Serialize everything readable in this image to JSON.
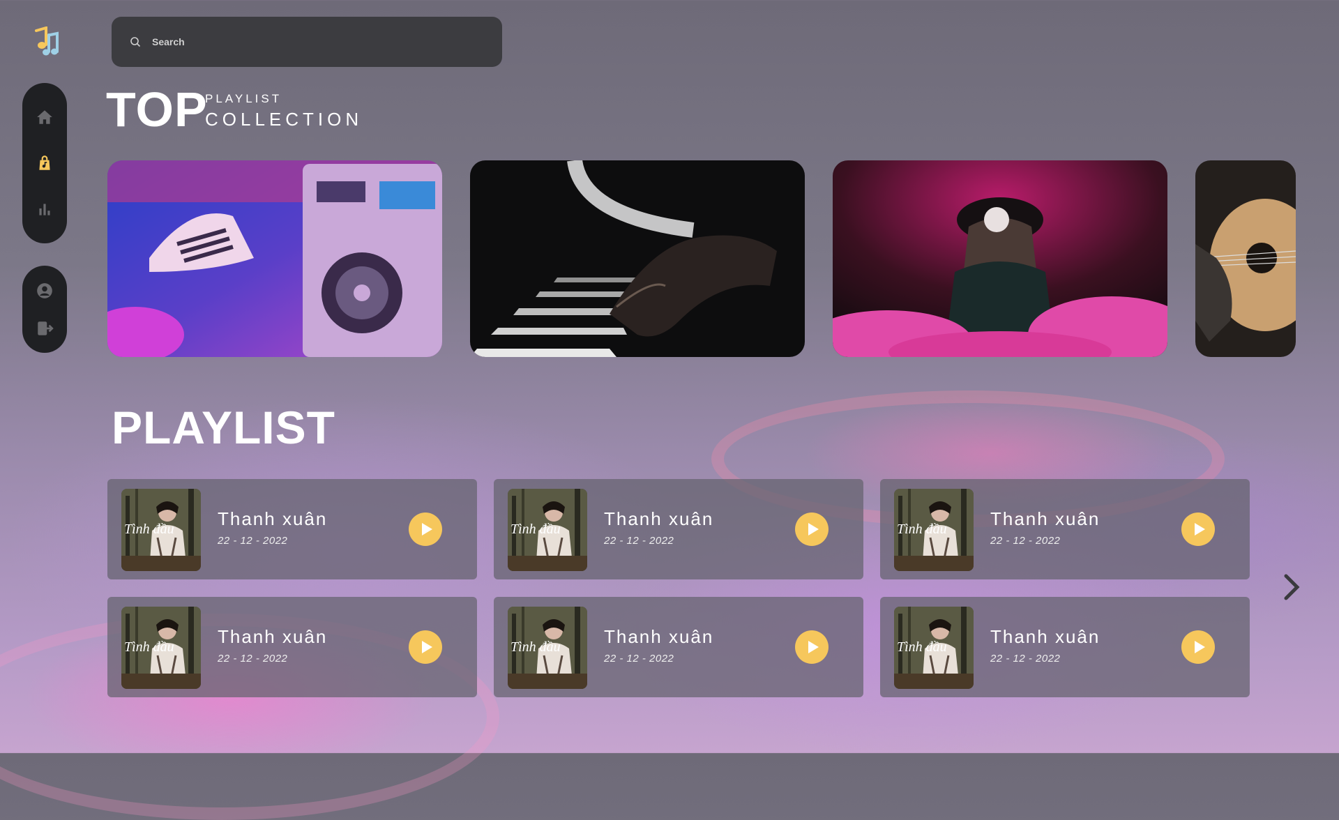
{
  "app": {
    "name": "Music"
  },
  "colors": {
    "accent": "#f6c75c",
    "nav_bg": "#1f2023",
    "search_bg": "#3c3c40"
  },
  "search": {
    "placeholder": "Search",
    "value": ""
  },
  "sidebar": {
    "top_items": [
      {
        "id": "home",
        "icon": "home-icon",
        "active": false
      },
      {
        "id": "playlist",
        "icon": "music-bag-icon",
        "active": true
      },
      {
        "id": "stats",
        "icon": "bar-chart-icon",
        "active": false
      }
    ],
    "bottom_items": [
      {
        "id": "profile",
        "icon": "user-icon"
      },
      {
        "id": "logout",
        "icon": "logout-icon"
      }
    ]
  },
  "header": {
    "big": "TOP",
    "small": "PLAYLIST",
    "sub": "COLLECTION"
  },
  "collection": [
    {
      "icon": "sneaker-boombox-image"
    },
    {
      "icon": "piano-hand-image"
    },
    {
      "icon": "hat-girl-smoke-image"
    },
    {
      "icon": "guitar-image"
    }
  ],
  "playlist": {
    "title": "PLAYLIST",
    "items": [
      {
        "title": "Thanh xuân",
        "date": "22 - 12 - 2022",
        "cover_text": "Tình đầu"
      },
      {
        "title": "Thanh xuân",
        "date": "22 - 12 - 2022",
        "cover_text": "Tình đầu"
      },
      {
        "title": "Thanh xuân",
        "date": "22 - 12 - 2022",
        "cover_text": "Tình đầu"
      },
      {
        "title": "Thanh xuân",
        "date": "22 - 12 - 2022",
        "cover_text": "Tình đầu"
      },
      {
        "title": "Thanh xuân",
        "date": "22 - 12 - 2022",
        "cover_text": "Tình đầu"
      },
      {
        "title": "Thanh xuân",
        "date": "22 - 12 - 2022",
        "cover_text": "Tình đầu"
      }
    ]
  }
}
